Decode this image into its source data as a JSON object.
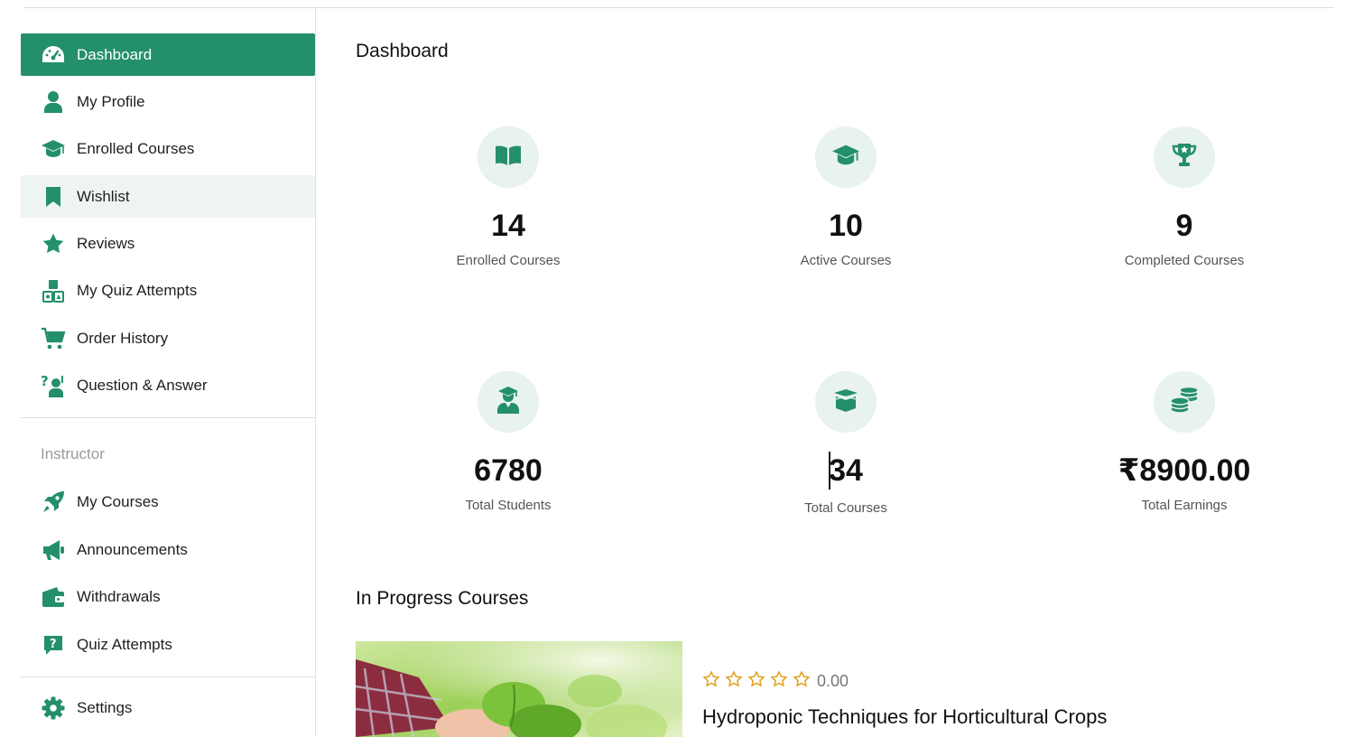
{
  "sidebar": {
    "items": [
      {
        "label": "Dashboard",
        "icon": "dashboard-gauge-icon"
      },
      {
        "label": "My Profile",
        "icon": "user-icon"
      },
      {
        "label": "Enrolled Courses",
        "icon": "graduation-cap-icon"
      },
      {
        "label": "Wishlist",
        "icon": "bookmark-icon"
      },
      {
        "label": "Reviews",
        "icon": "star-icon"
      },
      {
        "label": "My Quiz Attempts",
        "icon": "shapes-blocks-icon"
      },
      {
        "label": "Order History",
        "icon": "cart-icon"
      },
      {
        "label": "Question & Answer",
        "icon": "question-person-icon"
      }
    ],
    "instructor_title": "Instructor",
    "instructor_items": [
      {
        "label": "My Courses",
        "icon": "rocket-icon"
      },
      {
        "label": "Announcements",
        "icon": "megaphone-icon"
      },
      {
        "label": "Withdrawals",
        "icon": "wallet-icon"
      },
      {
        "label": "Quiz Attempts",
        "icon": "question-box-icon"
      }
    ],
    "settings_label": "Settings"
  },
  "main": {
    "title": "Dashboard",
    "stats": [
      {
        "value": "14",
        "label": "Enrolled Courses",
        "icon": "book-open-icon"
      },
      {
        "value": "10",
        "label": "Active Courses",
        "icon": "graduation-cap-icon"
      },
      {
        "value": "9",
        "label": "Completed Courses",
        "icon": "trophy-icon"
      },
      {
        "value": "6780",
        "label": "Total Students",
        "icon": "student-icon"
      },
      {
        "value": "34",
        "label": "Total Courses",
        "icon": "open-box-icon"
      },
      {
        "value": "₹8900.00",
        "label": "Total Earnings",
        "icon": "coins-icon"
      }
    ],
    "in_progress_title": "In Progress Courses",
    "course": {
      "rating": "0.00",
      "stars_filled": 0,
      "stars_total": 5,
      "title": "Hydroponic Techniques for Horticultural Crops"
    }
  },
  "colors": {
    "accent": "#248f6b",
    "icon_bg": "#e8f2ee",
    "star": "#e0a11b"
  }
}
